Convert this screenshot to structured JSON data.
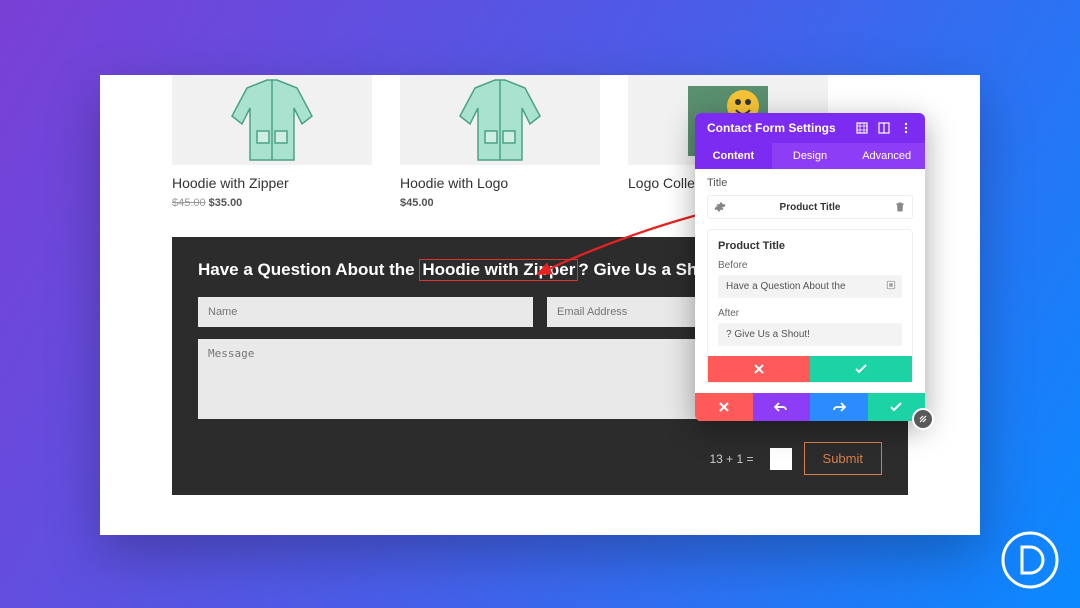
{
  "products": [
    {
      "name": "Hoodie with Zipper",
      "old_price": "$45.00",
      "price": "$35.00"
    },
    {
      "name": "Hoodie with Logo",
      "old_price": "",
      "price": "$45.00"
    },
    {
      "name": "Logo Collec",
      "old_price": "",
      "price": ""
    }
  ],
  "contact": {
    "title_before": "Have a Question About the ",
    "title_dynamic": "Hoodie with Zipper",
    "title_after": "? Give Us a Shout!",
    "name_ph": "Name",
    "email_ph": "Email Address",
    "message_ph": "Message",
    "captcha": "13 + 1 =",
    "submit": "Submit"
  },
  "panel": {
    "header": "Contact Form Settings",
    "tabs": {
      "content": "Content",
      "design": "Design",
      "advanced": "Advanced"
    },
    "section_label": "Title",
    "title_token": "Product Title",
    "inner": {
      "heading": "Product Title",
      "before_label": "Before",
      "before_value": "Have a Question About the",
      "after_label": "After",
      "after_value": "? Give Us a Shout!"
    }
  }
}
